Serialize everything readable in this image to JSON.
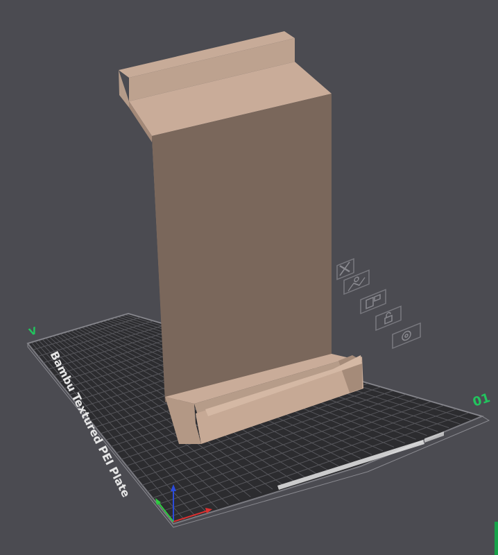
{
  "viewport": {
    "background_color": "#4b4b51",
    "bed": {
      "plate_name": "Bambu Textured PEI Plate",
      "plate_number": "01",
      "front_mark": "V",
      "bed_color": "#2c2c2f",
      "grid_color": "#56565b",
      "border_color": "#7a7a80"
    },
    "model": {
      "light_face_color": "#c9ac99",
      "mid_face_color": "#ae9482",
      "dark_face_color": "#7a675b"
    },
    "plate_tools": [
      {
        "name": "close-icon",
        "label": "Remove plate"
      },
      {
        "name": "image-icon",
        "label": "Preview"
      },
      {
        "name": "arrange-icon",
        "label": "Arrange"
      },
      {
        "name": "lock-icon",
        "label": "Lock"
      },
      {
        "name": "gear-icon",
        "label": "Settings"
      }
    ],
    "axes": {
      "x_color": "#d93030",
      "y_color": "#2ecc40",
      "z_color": "#2b4bdc"
    }
  }
}
